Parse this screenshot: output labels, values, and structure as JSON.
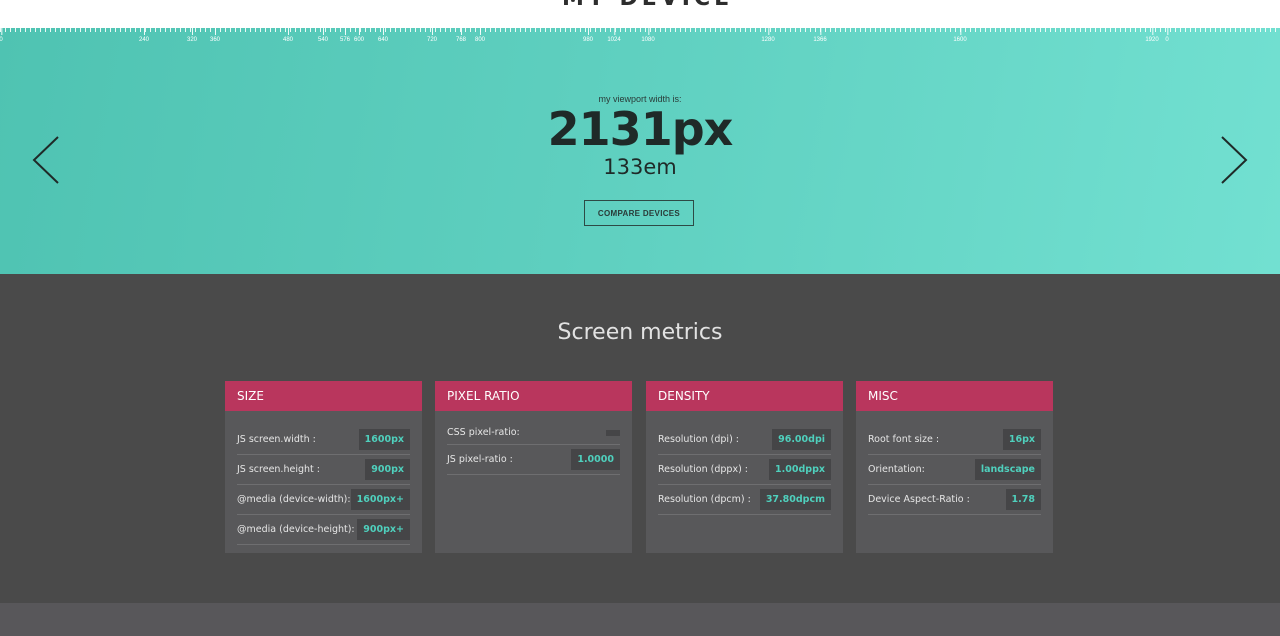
{
  "logo": {
    "text": "MY DEVICE"
  },
  "ruler": {
    "labels": [
      "0",
      "240",
      "320",
      "360",
      "480",
      "540",
      "576",
      "600",
      "640",
      "720",
      "768",
      "800",
      "980",
      "1024",
      "1080",
      "1280",
      "1366",
      "1600",
      "1920",
      "0"
    ]
  },
  "hero": {
    "caption": "my viewport width is:",
    "width_px": "2131px",
    "width_em": "133em",
    "compare_button": "COMPARE DEVICES"
  },
  "metrics": {
    "title": "Screen metrics",
    "cards": [
      {
        "title": "SIZE",
        "rows": [
          {
            "label": "JS screen.width :",
            "value": "1600px"
          },
          {
            "label": "JS screen.height :",
            "value": "900px"
          },
          {
            "label": "@media (device-width):",
            "value": "1600px+"
          },
          {
            "label": "@media (device-height):",
            "value": "900px+"
          }
        ]
      },
      {
        "title": "PIXEL RATIO",
        "rows": [
          {
            "label": "CSS pixel-ratio:",
            "value": ""
          },
          {
            "label": "JS pixel-ratio :",
            "value": "1.0000"
          }
        ]
      },
      {
        "title": "DENSITY",
        "rows": [
          {
            "label": "Resolution (dpi) :",
            "value": "96.00dpi"
          },
          {
            "label": "Resolution (dppx) :",
            "value": "1.00dppx"
          },
          {
            "label": "Resolution (dpcm) :",
            "value": "37.80dpcm"
          }
        ]
      },
      {
        "title": "MISC",
        "rows": [
          {
            "label": "Root font size :",
            "value": "16px"
          },
          {
            "label": "Orientation:",
            "value": "landscape"
          },
          {
            "label": "Device Aspect-Ratio :",
            "value": "1.78"
          }
        ]
      }
    ]
  },
  "colors": {
    "teal": "#5ecfbf",
    "header_pink": "#b9365d",
    "value_teal": "#4fd0bd",
    "dark_bg": "#4a4a4a",
    "card_bg": "#58585a"
  },
  "icons": {
    "prev": "chevron-left-icon",
    "next": "chevron-right-icon"
  }
}
